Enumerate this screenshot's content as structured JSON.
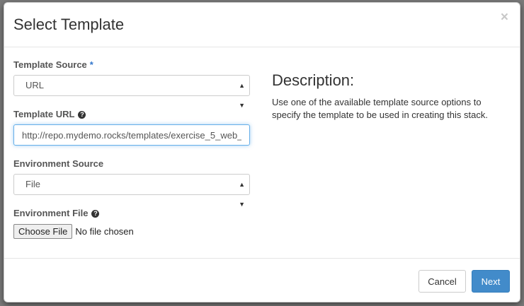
{
  "modal": {
    "title": "Select Template",
    "close_label": "×"
  },
  "form": {
    "template_source": {
      "label": "Template Source",
      "required_marker": "*",
      "selected": "URL"
    },
    "template_url": {
      "label": "Template URL",
      "help_icon": "question-circle-icon",
      "value": "http://repo.mydemo.rocks/templates/exercise_5_web_"
    },
    "environment_source": {
      "label": "Environment Source",
      "selected": "File"
    },
    "environment_file": {
      "label": "Environment File",
      "help_icon": "question-circle-icon",
      "button_label": "Choose File",
      "status": "No file chosen"
    }
  },
  "description": {
    "title": "Description:",
    "text": "Use one of the available template source options to specify the template to be used in creating this stack."
  },
  "footer": {
    "cancel_label": "Cancel",
    "next_label": "Next"
  },
  "colors": {
    "primary": "#428bca",
    "required": "#3377cc",
    "focus_border": "#66afe9"
  }
}
